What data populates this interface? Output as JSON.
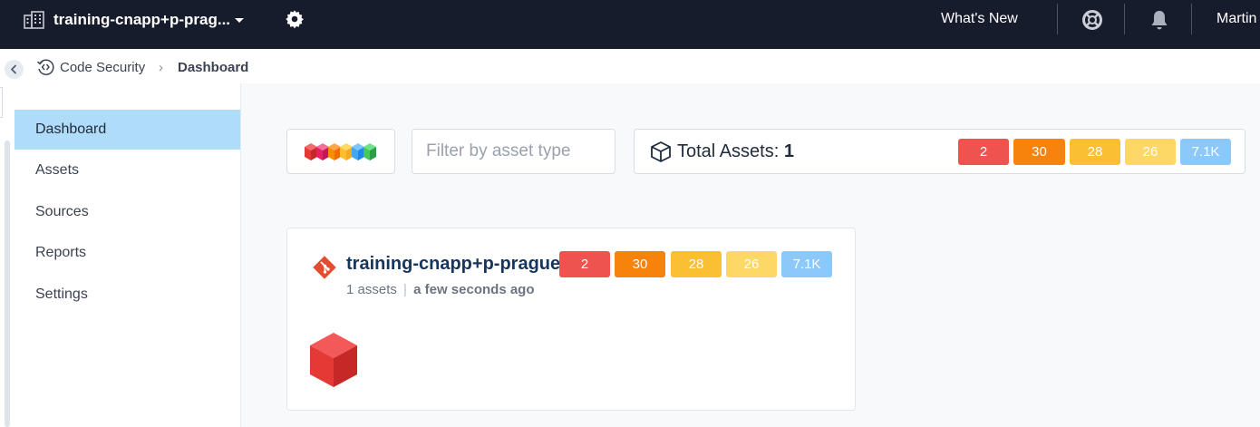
{
  "topbar": {
    "org_name": "training-cnapp+p-prag...",
    "whats_new": "What's New",
    "user_name": "Martin"
  },
  "breadcrumb": {
    "root": "Code Security",
    "separator": "›",
    "current": "Dashboard"
  },
  "sidebar": {
    "items": [
      {
        "label": "Dashboard",
        "active": true
      },
      {
        "label": "Assets",
        "active": false
      },
      {
        "label": "Sources",
        "active": false
      },
      {
        "label": "Reports",
        "active": false
      },
      {
        "label": "Settings",
        "active": false
      }
    ]
  },
  "toolbar": {
    "filter_placeholder": "Filter by asset type",
    "total_assets_label": "Total Assets:",
    "total_assets_value": "1",
    "severity_counts": {
      "critical": "2",
      "high": "30",
      "medium": "28",
      "low": "26",
      "info": "7.1K"
    }
  },
  "source_card": {
    "title": "training-cnapp+p-prague",
    "assets_count": "1 assets",
    "separator": "|",
    "updated": "a few seconds ago",
    "severity_counts": {
      "critical": "2",
      "high": "30",
      "medium": "28",
      "low": "26",
      "info": "7.1K"
    }
  },
  "colors": {
    "topbar_bg": "#161c2c",
    "active_nav_bg": "#aedcf9",
    "critical": "#ef5350",
    "high": "#f7820c",
    "medium": "#fbbf34",
    "low": "#fdd867",
    "info": "#8cc8fa",
    "git_brand": "#e44c30"
  },
  "icons": [
    "building-icon",
    "chevron-down-icon",
    "gear-icon",
    "lifebuoy-icon",
    "bell-icon",
    "chevron-left-icon",
    "code-security-icon",
    "cube-outline-icon",
    "git-icon",
    "red-cube-icon",
    "multi-cube-logo-icon"
  ]
}
